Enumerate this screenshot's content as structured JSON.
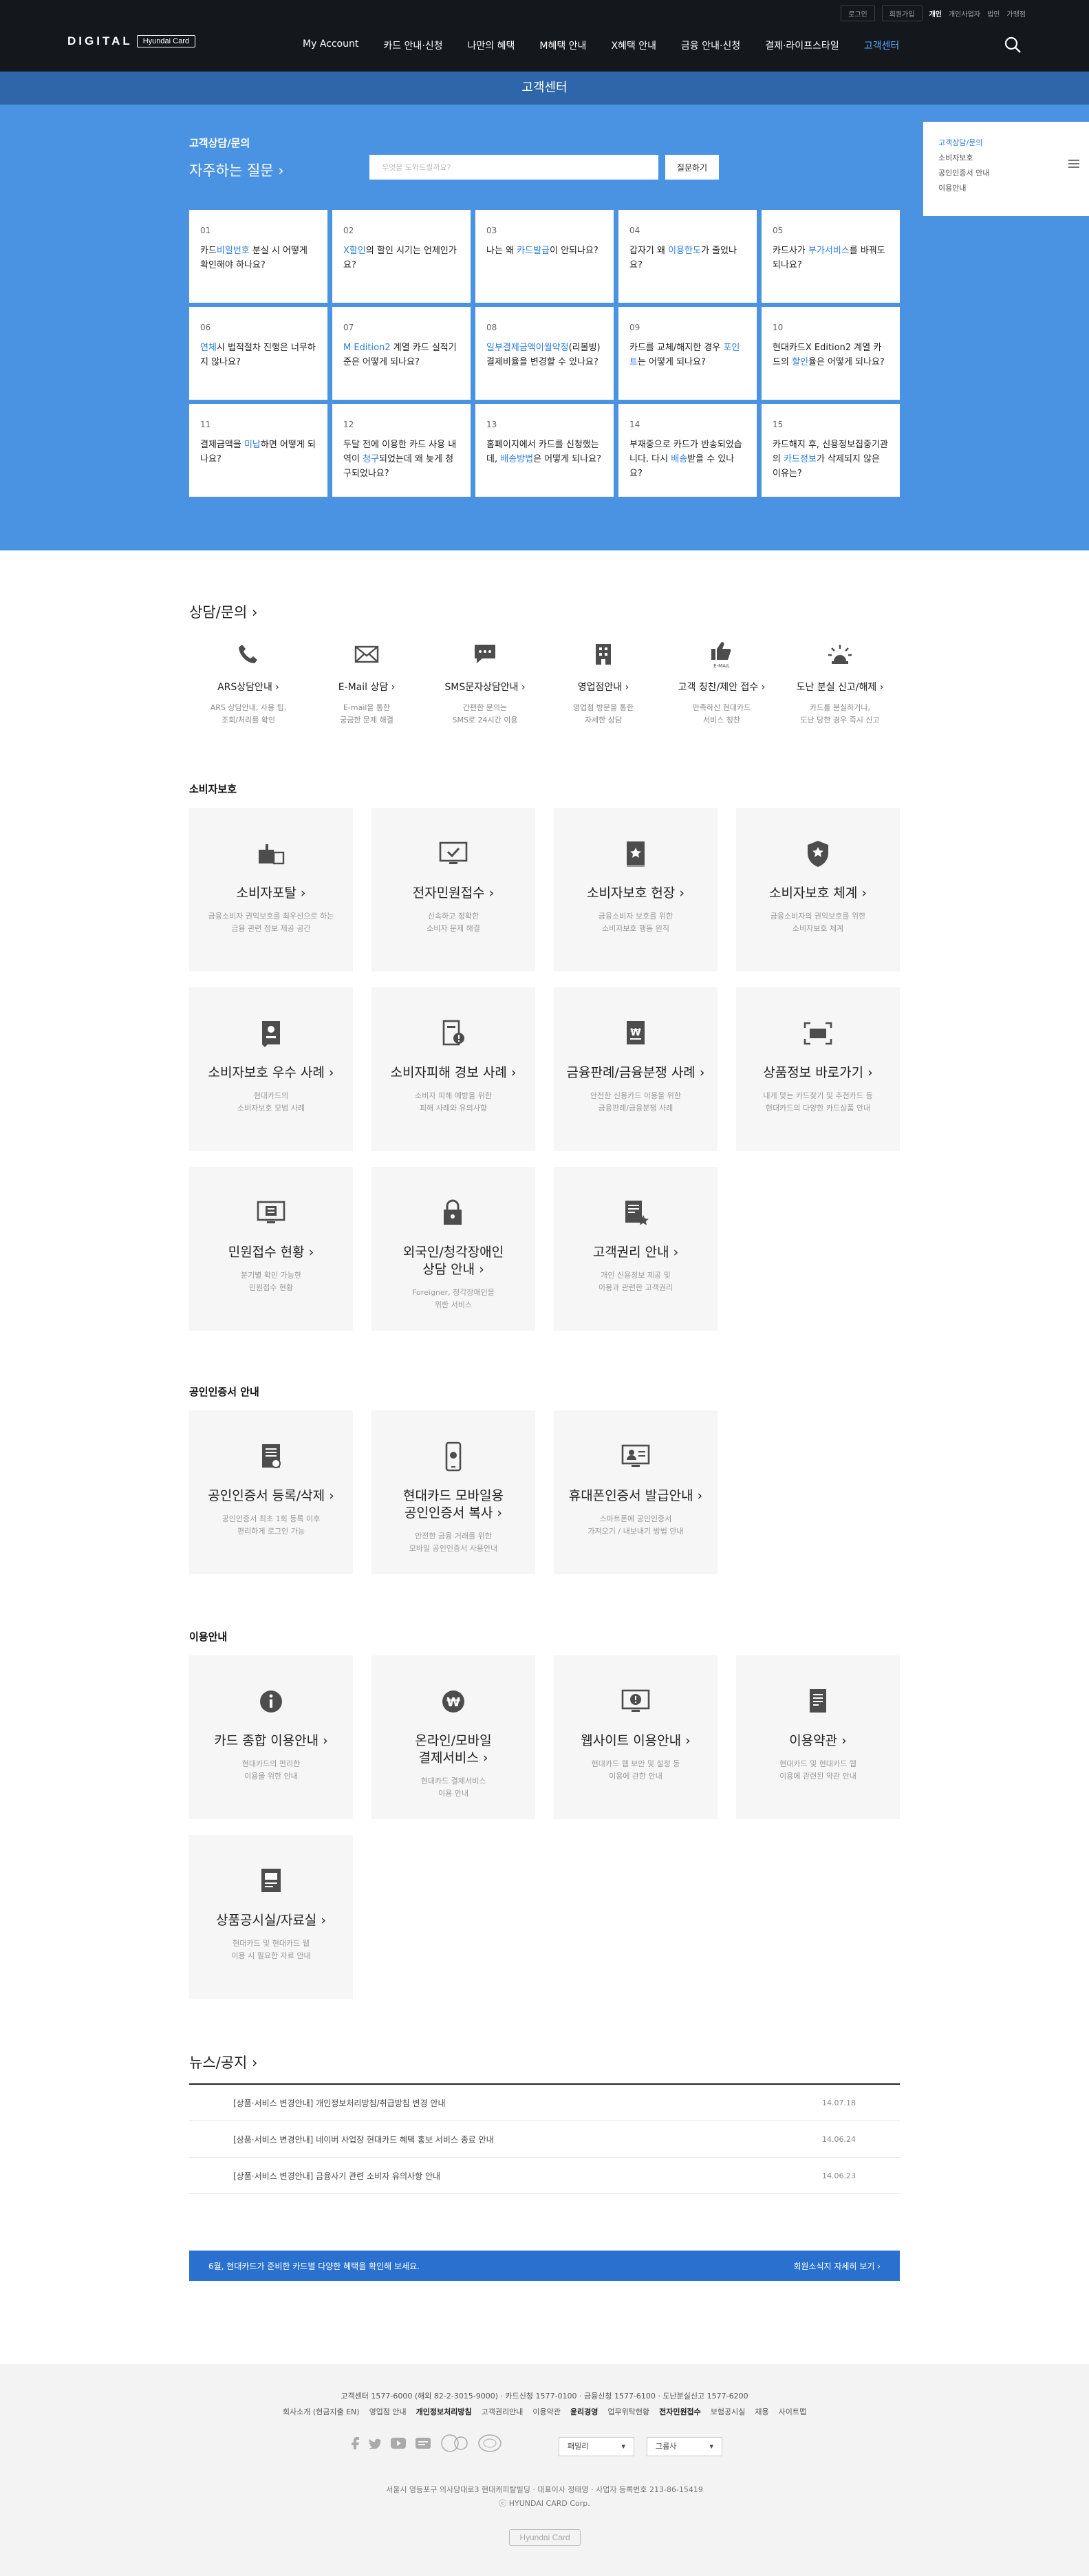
{
  "header": {
    "util": {
      "login": "로그인",
      "join": "회원가입",
      "personal": "개인",
      "business": "개인사업자",
      "corporate": "법인",
      "merchant": "가맹점"
    },
    "logo_main": "DIGITAL",
    "logo_sub": "Hyundai Card",
    "gnb": [
      "My Account",
      "카드 안내·신청",
      "나만의 혜택",
      "M혜택 안내",
      "X혜택 안내",
      "금융 안내·신청",
      "결제·라이프스타일",
      "고객센터"
    ],
    "subbar_title": "고객센터"
  },
  "hero": {
    "label": "고객상담/문의",
    "faq_title": "자주하는 질문",
    "search_placeholder": "무엇을 도와드릴까요?",
    "search_button": "질문하기",
    "faqs": [
      {
        "num": "01",
        "pre": "카드",
        "hl": "비밀번호",
        "post": " 분실 시 어떻게 확인해야 하나요?"
      },
      {
        "num": "02",
        "pre": "",
        "hl": "X할인",
        "post": "의 할인 시기는 언제인가요?"
      },
      {
        "num": "03",
        "pre": "나는 왜 ",
        "hl": "카드발급",
        "post": "이 안되나요?"
      },
      {
        "num": "04",
        "pre": "갑자기 왜 ",
        "hl": "이용한도",
        "post": "가 줄었나요?"
      },
      {
        "num": "05",
        "pre": "카드사가 ",
        "hl": "부가서비스",
        "post": "를 바꿔도 되나요?"
      },
      {
        "num": "06",
        "pre": "",
        "hl": "연체",
        "post": "시 법적절차 진행은 너무하지 않나요?"
      },
      {
        "num": "07",
        "pre": "",
        "hl": "M Edition2",
        "post": " 계열 카드 실적기준은 어떻게 되나요?"
      },
      {
        "num": "08",
        "pre": "",
        "hl": "일부결제금액이월약정",
        "post": "(리볼빙)결제비율을 변경할 수 있나요?"
      },
      {
        "num": "09",
        "pre": "카드를 교체/해지한 경우 ",
        "hl": "포인트",
        "post": "는 어떻게 되나요?"
      },
      {
        "num": "10",
        "pre": "현대카드X Edition2 계열 카드의 ",
        "hl": "할인",
        "post": "율은 어떻게 되나요?"
      },
      {
        "num": "11",
        "pre": "결제금액을 ",
        "hl": "미납",
        "post": "하면 어떻게 되나요?"
      },
      {
        "num": "12",
        "pre": "두달 전에 이용한 카드 사용 내역이 ",
        "hl": "청구",
        "post": "되었는데 왜 늦게 청구되었나요?"
      },
      {
        "num": "13",
        "pre": "홈페이지에서 카드를 신청했는데, ",
        "hl": "배송방법",
        "post": "은 어떻게 되나요?"
      },
      {
        "num": "14",
        "pre": "부재중으로 카드가 반송되었습니다. 다시 ",
        "hl": "배송",
        "post": "받을 수 있나요?"
      },
      {
        "num": "15",
        "pre": "카드해지 후, 신용정보집중기관의 ",
        "hl": "카드정보",
        "post": "가 삭제되지 않은 이유는?"
      }
    ],
    "side": [
      "고객상담/문의",
      "소비자보호",
      "공인인증서 안내",
      "이용안내"
    ]
  },
  "contact": {
    "title": "상담/문의",
    "items": [
      {
        "icon": "phone-icon",
        "title": "ARS상담안내",
        "desc1": "ARS 상담안내, 사용 팁,",
        "desc2": "조회/처리를 확인"
      },
      {
        "icon": "email-icon",
        "title": "E-Mail 상담",
        "desc1": "E-mail을 통한",
        "desc2": "궁금한 문제 해결"
      },
      {
        "icon": "sms-icon",
        "title": "SMS문자상담안내",
        "desc1": "간편한 문의는",
        "desc2": "SMS로 24시간 이용"
      },
      {
        "icon": "branch-icon",
        "title": "영업점안내",
        "desc1": "영업점 방문을 통한",
        "desc2": "자세한 상담"
      },
      {
        "icon": "thumbs-up-icon",
        "title": "고객 칭찬/제안 접수",
        "desc1": "만족하신 현대카드",
        "desc2": "서비스 칭찬"
      },
      {
        "icon": "alert-icon",
        "title": "도난 분실 신고/해제",
        "desc1": "카드를 분실하거나,",
        "desc2": "도난 당한 경우 즉시 신고"
      }
    ]
  },
  "consumer": {
    "title": "소비자보호",
    "cards": [
      {
        "icon": "portal-icon",
        "t1": "소비자포탈",
        "t2": "",
        "d1": "금융소비자 권익보호를 최우선으로 하는",
        "d2": "금융 관련 정보 제공 공간"
      },
      {
        "icon": "monitor-check-icon",
        "t1": "전자민원접수",
        "t2": "",
        "d1": "신속하고 정확한",
        "d2": "소비자 문제 해결"
      },
      {
        "icon": "book-icon",
        "t1": "소비자보호 헌장",
        "t2": "",
        "d1": "금융소비자 보호를 위한",
        "d2": "소비자보호 행동 원칙"
      },
      {
        "icon": "shield-star-icon",
        "t1": "소비자보호 체계",
        "t2": "",
        "d1": "금융소비자의 권익보호를 위한",
        "d2": "소비자보호 체계"
      },
      {
        "icon": "badge-doc-icon",
        "t1": "소비자보호 우수 사례",
        "t2": "",
        "d1": "현대카드의",
        "d2": "소비자보호 모범 사례"
      },
      {
        "icon": "warning-doc-icon",
        "t1": "소비자피해 경보 사례",
        "t2": "",
        "d1": "소비자 피해 예방을 위한",
        "d2": "피해 사례와 유의사항"
      },
      {
        "icon": "dispute-doc-icon",
        "t1": "금융판례/금융분쟁 사례",
        "t2": "",
        "d1": "안전한 신용카드 이용을 위한",
        "d2": "금융판례/금융분쟁 사례"
      },
      {
        "icon": "scan-icon",
        "t1": "상품정보 바로가기",
        "t2": "",
        "d1": "내게 맞는 카드찾기 및 추천카드 등",
        "d2": "현대카드의 다양한 카드상품 안내"
      },
      {
        "icon": "monitor-doc-icon",
        "t1": "민원접수 현황",
        "t2": "",
        "d1": "분기별 확인 가능한",
        "d2": "민원접수 현황"
      },
      {
        "icon": "lock-person-icon",
        "t1": "외국인/청각장애인",
        "t2": "상담 안내",
        "d1": "Foreigner, 청각장애인을",
        "d2": "위한 서비스"
      },
      {
        "icon": "doc-star-icon",
        "t1": "고객권리 안내",
        "t2": "",
        "d1": "개인 신용정보 제공 및",
        "d2": "이용과 관련한 고객권리"
      }
    ]
  },
  "cert": {
    "title": "공인인증서 안내",
    "cards": [
      {
        "icon": "cert-doc-icon",
        "t1": "공인인증서 등록/삭제",
        "t2": "",
        "d1": "공인인증서 최초 1회 등록 이후",
        "d2": "편리하게 로그인 가능"
      },
      {
        "icon": "mobile-icon",
        "t1": "현대카드 모바일용",
        "t2": "공인인증서 복사",
        "d1": "안전한 금융 거래를 위한",
        "d2": "모바일 공인인증서 사용안내"
      },
      {
        "icon": "monitor-person-icon",
        "t1": "휴대폰인증서 발급안내",
        "t2": "",
        "d1": "스마트폰에 공인인증서",
        "d2": "가져오기 / 내보내기 방법 안내"
      }
    ]
  },
  "usage": {
    "title": "이용안내",
    "cards": [
      {
        "icon": "info-icon",
        "t1": "카드 종합 이용안내",
        "t2": "",
        "d1": "현대카드의 편리한",
        "d2": "이용을 위한 안내"
      },
      {
        "icon": "won-icon",
        "t1": "온라인/모바일",
        "t2": "결제서비스",
        "d1": "현대카드 결제서비스",
        "d2": "이용 안내"
      },
      {
        "icon": "monitor-alert-icon",
        "t1": "웹사이트 이용안내",
        "t2": "",
        "d1": "현대카드 웹 보안 및 설정 등",
        "d2": "이용에 관한 안내"
      },
      {
        "icon": "terms-icon",
        "t1": "이용약관",
        "t2": "",
        "d1": "현대카드 및 현대카드 웹",
        "d2": "이용에 관련된 약관 안내"
      },
      {
        "icon": "catalog-icon",
        "t1": "상품공시실/자료실",
        "t2": "",
        "d1": "현대카드 및 현대카드 웹",
        "d2": "이용 시 필요한 자료 안내"
      }
    ]
  },
  "news": {
    "title": "뉴스/공지",
    "items": [
      {
        "text": "[상품·서비스 변경안내] 개인정보처리방침/취급방침 변경 안내",
        "date": "14.07.18"
      },
      {
        "text": "[상품·서비스 변경안내] 네이버 사업장 현대카드 혜택 홍보 서비스 종료 안내",
        "date": "14.06.24"
      },
      {
        "text": "[상품·서비스 변경안내] 금융사기 관련 소비자 유의사항 안내",
        "date": "14.06.23"
      }
    ],
    "banner_left": "6월, 현대카드가 준비한 카드별 다양한 혜택을 확인해 보세요.",
    "banner_right": "회원소식지 자세히 보기"
  },
  "footer": {
    "contact_line": "고객센터 1577-6000 (해외 82-2-3015-9000) · 카드신청 1577-0100 · 금융신청 1577-6100 · 도난분실신고 1577-6200",
    "links": [
      "회사소개 (현금지출 EN)",
      "영업점 안내",
      "개인정보처리방침",
      "고객권리안내",
      "이용약관",
      "윤리경영",
      "업무위탁현황",
      "전자민원접수",
      "보험공시실",
      "채용",
      "사이트맵"
    ],
    "select1": "패밀리",
    "select2": "그룹사",
    "address": "서울시 영등포구 의사당대로3 현대캐피탈빌딩 · 대표이사 정태영 · 사업자 등록번호 213-86-15419",
    "copyright": "ⓒ HYUNDAI CARD Corp.",
    "logo": "Hyundai Card"
  }
}
